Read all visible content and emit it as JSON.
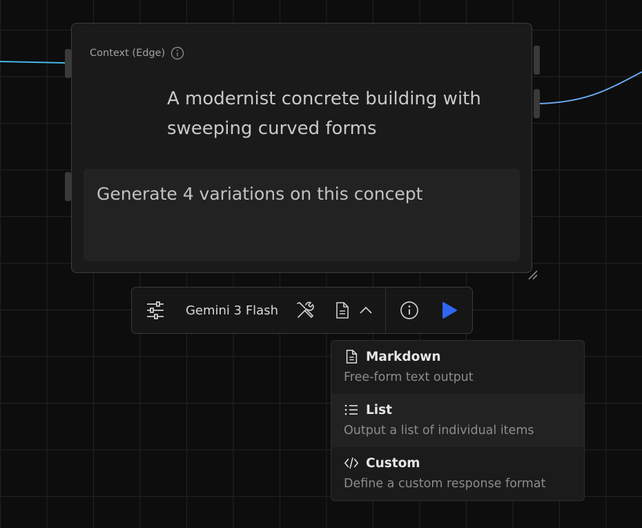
{
  "node": {
    "context_label": "Context (Edge)",
    "context_text": "A modernist concrete building with sweeping curved forms",
    "prompt_text": "Generate 4 variations on this concept"
  },
  "toolbar": {
    "settings_icon": "sliders-icon",
    "model_label": "Gemini 3 Flash",
    "tools_icon": "tools-icon",
    "format_icon": "document-icon",
    "chevron_icon": "chevron-up-icon",
    "info_icon": "info-icon",
    "run_icon": "play-icon"
  },
  "colors": {
    "background": "#0d0d0d",
    "edge_left": "#49b7e6",
    "edge_right": "#6aa8f0",
    "run_button": "#2f66f2"
  },
  "format_menu": {
    "items": [
      {
        "icon": "document-icon",
        "title": "Markdown",
        "description": "Free-form text output"
      },
      {
        "icon": "list-icon",
        "title": "List",
        "description": "Output a list of individual items"
      },
      {
        "icon": "code-icon",
        "title": "Custom",
        "description": "Define a custom response format"
      }
    ]
  }
}
